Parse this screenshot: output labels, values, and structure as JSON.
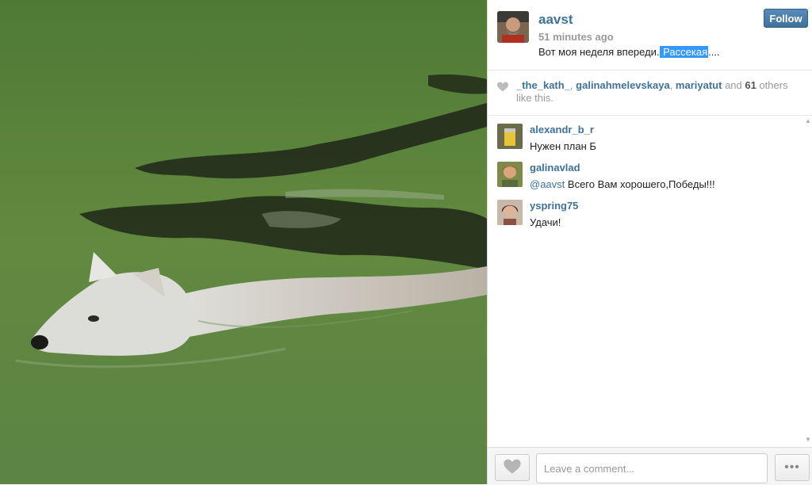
{
  "post": {
    "username": "aavst",
    "timestamp": "51 minutes ago",
    "caption_before": "Вот моя неделя впереди.",
    "caption_selected": " Рассекая",
    "caption_after": "....",
    "follow_label": "Follow"
  },
  "likes": {
    "users": [
      "_the_kath_",
      "galinahmelevskaya",
      "mariyatut"
    ],
    "sep": ", ",
    "and_text": " and ",
    "others_count": "61",
    "others_text": " others like this."
  },
  "comments": [
    {
      "user": "alexandr_b_r",
      "mention": "",
      "text": "Нужен план Б"
    },
    {
      "user": "galinavlad",
      "mention": "@aavst",
      "text": " Всего Вам хорошего,Победы!!!"
    },
    {
      "user": "yspring75",
      "mention": "",
      "text": "Удачи!"
    }
  ],
  "footer": {
    "comment_placeholder": "Leave a comment...",
    "more_label": "•••"
  },
  "colors": {
    "link": "#3f729b",
    "follow_button": "#3f729b",
    "selection": "#3399ff",
    "muted": "#999999"
  },
  "icons": {
    "likes": "heart-icon",
    "like_button": "heart-icon",
    "more": "ellipsis-icon"
  }
}
